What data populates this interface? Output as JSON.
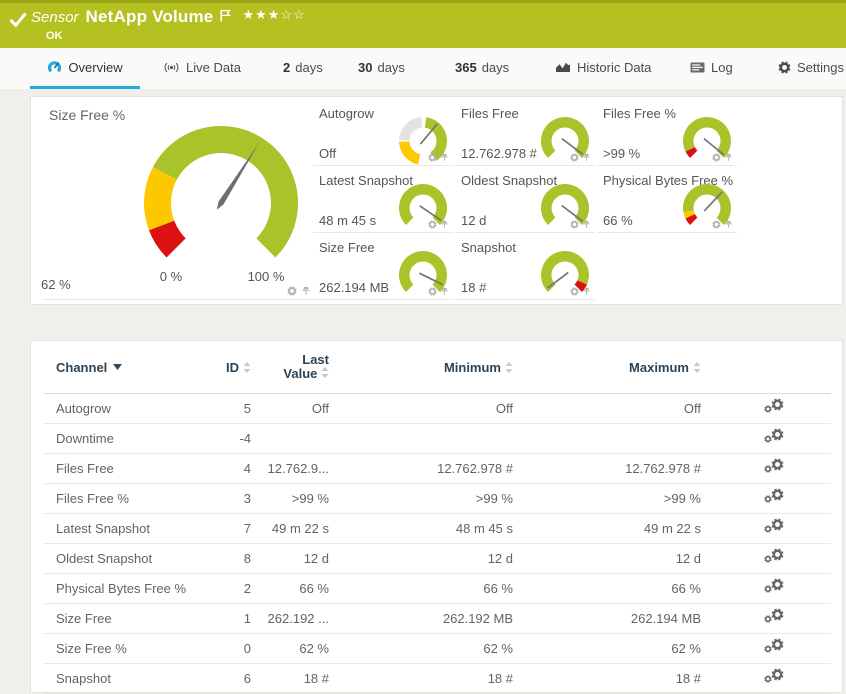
{
  "header": {
    "kind": "Sensor",
    "name": "NetApp Volume",
    "status": "OK",
    "stars": {
      "filled": 3,
      "total": 5
    },
    "bar_color": "#b5c120"
  },
  "tabs": [
    {
      "icon": "gauge",
      "label": "Overview",
      "active": true
    },
    {
      "icon": "broadcast",
      "label": "Live Data"
    },
    {
      "num": "2",
      "label": "days"
    },
    {
      "num": "30",
      "label": "days"
    },
    {
      "num": "365",
      "label": "days"
    },
    {
      "icon": "chart",
      "label": "Historic Data"
    },
    {
      "icon": "log",
      "label": "Log"
    },
    {
      "icon": "settings",
      "label": "Settings"
    }
  ],
  "chart_data": {
    "type": "gauge-set",
    "big_gauge": {
      "label": "Size Free %",
      "value_text": "62 %",
      "value": 0.62,
      "min_label": "0 %",
      "max_label": "100 %",
      "segments": [
        {
          "color": "#dc1212",
          "from": 0,
          "to": 0.09
        },
        {
          "color": "#fdc800",
          "from": 0.09,
          "to": 0.27
        },
        {
          "color": "#a9c32b",
          "from": 0.27,
          "to": 1
        }
      ]
    },
    "small_gauges": [
      {
        "label": "Autogrow",
        "value": "Off",
        "type": "ring",
        "needle_abs": 40,
        "segments_abs": [
          {
            "color": "#fdc800",
            "from": 192,
            "to": 268
          },
          {
            "color": "#e3e3e1",
            "from": 272,
            "to": 356
          },
          {
            "color": "#a9c32b",
            "from": 368,
            "to": 506
          }
        ]
      },
      {
        "label": "Files Free",
        "value": "12.762.978 #",
        "needle": 0.97,
        "segments": [
          {
            "color": "#a9c32b",
            "from": 0,
            "to": 1
          }
        ]
      },
      {
        "label": "Files Free %",
        "value": ">99 %",
        "needle": 0.98,
        "segments": [
          {
            "color": "#dc1212",
            "from": 0,
            "to": 0.07
          },
          {
            "color": "#a9c32b",
            "from": 0.07,
            "to": 1
          }
        ]
      },
      {
        "label": "Latest Snapshot",
        "value": "48 m 45 s",
        "needle": 0.96,
        "segments": [
          {
            "color": "#a9c32b",
            "from": 0,
            "to": 1
          }
        ]
      },
      {
        "label": "Oldest Snapshot",
        "value": "12 d",
        "needle": 0.97,
        "segments": [
          {
            "color": "#a9c32b",
            "from": 0,
            "to": 1
          }
        ]
      },
      {
        "label": "Physical Bytes Free %",
        "value": "66 %",
        "needle": 0.66,
        "segments": [
          {
            "color": "#dc1212",
            "from": 0,
            "to": 0.07
          },
          {
            "color": "#fdc800",
            "from": 0.07,
            "to": 0.13
          },
          {
            "color": "#a9c32b",
            "from": 0.13,
            "to": 1
          }
        ]
      },
      {
        "label": "Size Free",
        "value": "262.194 MB",
        "needle": 0.93,
        "segments": [
          {
            "color": "#a9c32b",
            "from": 0,
            "to": 1
          }
        ]
      },
      {
        "label": "Snapshot",
        "value": "18 #",
        "needle": 0.03,
        "segments": [
          {
            "color": "#a9c32b",
            "from": 0,
            "to": 0.92
          },
          {
            "color": "#dc1212",
            "from": 0.92,
            "to": 1
          }
        ]
      }
    ]
  },
  "table": {
    "columns": [
      {
        "label": "Channel",
        "sorted": true
      },
      {
        "label": "ID",
        "sortable": true
      },
      {
        "label": "Last Value",
        "sortable": true,
        "two_line": true
      },
      {
        "label": "Minimum",
        "sortable": true
      },
      {
        "label": "Maximum",
        "sortable": true
      }
    ],
    "rows": [
      {
        "channel": "Autogrow",
        "id": "5",
        "last": "Off",
        "min": "Off",
        "max": "Off"
      },
      {
        "channel": "Downtime",
        "id": "-4",
        "last": "",
        "min": "",
        "max": ""
      },
      {
        "channel": "Files Free",
        "id": "4",
        "last": "12.762.9...",
        "min": "12.762.978 #",
        "max": "12.762.978 #"
      },
      {
        "channel": "Files Free %",
        "id": "3",
        "last": ">99 %",
        "min": ">99 %",
        "max": ">99 %"
      },
      {
        "channel": "Latest Snapshot",
        "id": "7",
        "last": "49 m 22 s",
        "min": "48 m 45 s",
        "max": "49 m 22 s"
      },
      {
        "channel": "Oldest Snapshot",
        "id": "8",
        "last": "12 d",
        "min": "12 d",
        "max": "12 d"
      },
      {
        "channel": "Physical Bytes Free %",
        "id": "2",
        "last": "66 %",
        "min": "66 %",
        "max": "66 %"
      },
      {
        "channel": "Size Free",
        "id": "1",
        "last": "262.192 ...",
        "min": "262.192 MB",
        "max": "262.194 MB"
      },
      {
        "channel": "Size Free %",
        "id": "0",
        "last": "62 %",
        "min": "62 %",
        "max": "62 %"
      },
      {
        "channel": "Snapshot",
        "id": "6",
        "last": "18 #",
        "min": "18 #",
        "max": "18 #"
      }
    ]
  }
}
